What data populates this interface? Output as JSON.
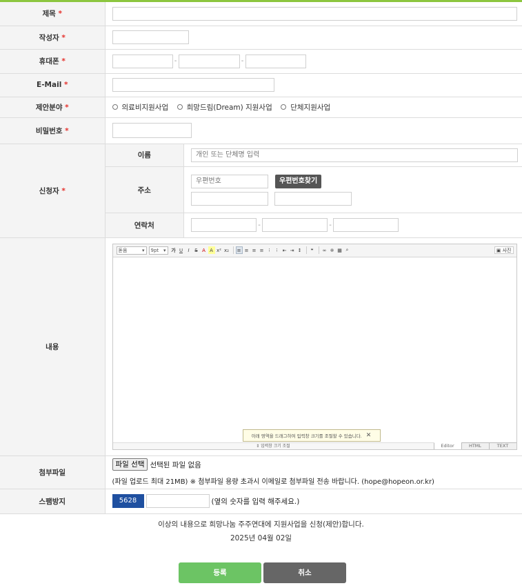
{
  "form": {
    "title": {
      "label": "제목",
      "required": "*"
    },
    "author": {
      "label": "작성자",
      "required": "*"
    },
    "phone": {
      "label": "휴대폰",
      "required": "*",
      "separator": "-"
    },
    "email": {
      "label": "E-Mail",
      "required": "*"
    },
    "category": {
      "label": "제안분야",
      "required": "*",
      "options": [
        "의료비지원사업",
        "희망드림(Dream) 지원사업",
        "단체지원사업"
      ]
    },
    "password": {
      "label": "비밀번호",
      "required": "*"
    },
    "applicant": {
      "label": "신청자",
      "required": "*",
      "name_label": "이름",
      "name_placeholder": "개인 또는 단체명 입력",
      "address_label": "주소",
      "zip_placeholder": "우편번호",
      "zip_button": "우편번호찾기",
      "contact_label": "연락처",
      "separator": "-"
    },
    "content": {
      "label": "내용",
      "toolbar": {
        "font": "돋움",
        "size": "9pt",
        "bold": "가",
        "photo": "사진"
      },
      "tip": "아래 영역을 드래그하여 입력창 크기를 조절할 수 있습니다.",
      "tip_close": "✕",
      "resize_label": "⇕ 입력창 크기 조절",
      "modes": [
        "Editor",
        "HTML",
        "TEXT"
      ]
    },
    "attachment": {
      "label": "첨부파일",
      "button": "파일 선택",
      "status": "선택된 파일 없음",
      "note": "(파일 업로드 최대 21MB) ※ 첨부파일 용량 초과시 이메일로 첨부파일 전송 바랍니다. (hope@hopeon.or.kr)"
    },
    "spam": {
      "label": "스팸방지",
      "code": "5628",
      "hint": "(옆의 숫자를 입력 해주세요.)"
    }
  },
  "confirm_text": "이상의 내용으로 희망나눔 주주연대에 지원사업을 신청(제안)합니다.",
  "date": "2025년 04월 02일",
  "buttons": {
    "submit": "등록",
    "cancel": "취소"
  },
  "colors": {
    "accent": "#8cc63f",
    "submit": "#6cc464",
    "cancel": "#666666",
    "captcha": "#1f50a0",
    "required": "#e5322d"
  }
}
